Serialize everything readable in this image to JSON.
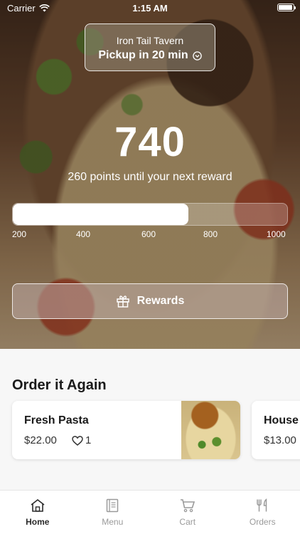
{
  "status_bar": {
    "carrier": "Carrier",
    "time": "1:15 AM"
  },
  "store": {
    "name": "Iron Tail Tavern",
    "pickup": "Pickup in 20 min"
  },
  "rewards": {
    "points": "740",
    "subtitle": "260 points until your next reward",
    "progress_fraction": 0.64,
    "ticks": [
      "200",
      "400",
      "600",
      "800",
      "1000"
    ],
    "button_label": "Rewards"
  },
  "order_again": {
    "title": "Order it Again",
    "items": [
      {
        "name": "Fresh Pasta",
        "price": "$22.00",
        "likes": "1"
      },
      {
        "name": "House",
        "price": "$13.00"
      }
    ]
  },
  "tabs": [
    {
      "label": "Home",
      "icon": "home-icon",
      "active": true
    },
    {
      "label": "Menu",
      "icon": "menu-icon",
      "active": false
    },
    {
      "label": "Cart",
      "icon": "cart-icon",
      "active": false
    },
    {
      "label": "Orders",
      "icon": "fork-knife-icon",
      "active": false
    }
  ],
  "colors": {
    "active_tab": "#2b2b2b",
    "inactive_tab": "#9a9a9a",
    "background": "#f7f7f7"
  }
}
